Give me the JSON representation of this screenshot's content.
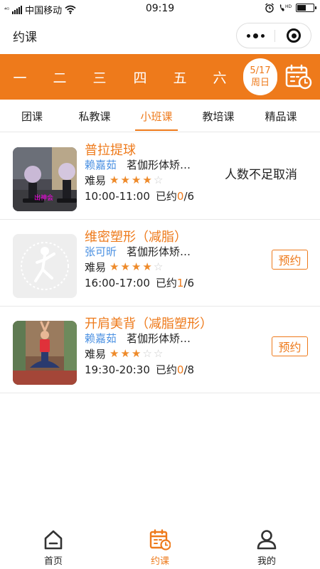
{
  "status_bar": {
    "network": "⁴ᴳ",
    "carrier": "中国移动",
    "time": "09:19",
    "battery_level": 0.55
  },
  "title_bar": {
    "title": "约课"
  },
  "week": {
    "days": [
      "一",
      "二",
      "三",
      "四",
      "五",
      "六"
    ],
    "current_date": "5/17",
    "current_weekday": "周日"
  },
  "tabs": [
    {
      "label": "团课",
      "active": false
    },
    {
      "label": "私教课",
      "active": false
    },
    {
      "label": "小班课",
      "active": true
    },
    {
      "label": "教培课",
      "active": false
    },
    {
      "label": "精品课",
      "active": false
    }
  ],
  "courses": [
    {
      "name": "普拉提球",
      "teacher": "赖嘉茹",
      "venue": "茗伽形体矫正馆",
      "difficulty_label": "难易",
      "difficulty": 4,
      "difficulty_max": 5,
      "time": "10:00-11:00",
      "booked_label": "已约",
      "booked": "0",
      "capacity": "/6",
      "status": "人数不足取消",
      "action": "",
      "thumb_caption": "出神会"
    },
    {
      "name": "维密塑形（减脂）",
      "teacher": "张可昕",
      "venue": "茗伽形体矫正馆",
      "difficulty_label": "难易",
      "difficulty": 4,
      "difficulty_max": 5,
      "time": "16:00-17:00",
      "booked_label": "已约",
      "booked": "1",
      "capacity": "/6",
      "status": "",
      "action": "预约",
      "thumb_caption": ""
    },
    {
      "name": "开肩美背（减脂塑形）",
      "teacher": "赖嘉茹",
      "venue": "茗伽形体矫正馆",
      "difficulty_label": "难易",
      "difficulty": 3,
      "difficulty_max": 5,
      "time": "19:30-20:30",
      "booked_label": "已约",
      "booked": "0",
      "capacity": "/8",
      "status": "",
      "action": "预约",
      "thumb_caption": ""
    }
  ],
  "bottom_nav": [
    {
      "label": "首页",
      "icon": "home-icon",
      "active": false
    },
    {
      "label": "约课",
      "icon": "calendar-icon",
      "active": true
    },
    {
      "label": "我的",
      "icon": "user-icon",
      "active": false
    }
  ],
  "colors": {
    "accent": "#ee7a1b",
    "teacher_link": "#4a90e2",
    "star_on": "#ee8a2a",
    "star_off": "#cccccc"
  }
}
